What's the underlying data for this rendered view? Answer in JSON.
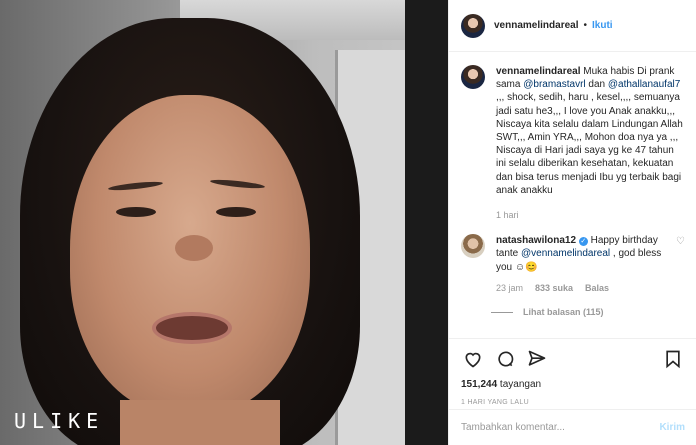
{
  "media": {
    "watermark": "ULIKE"
  },
  "header": {
    "username": "vennamelindareal",
    "separator": "•",
    "follow_label": "Ikuti"
  },
  "caption": {
    "username": "vennamelindareal",
    "text_1": " Muka habis Di prank sama ",
    "mention_1": "@bramastavrl",
    "text_2": " dan ",
    "mention_2": "@athallanaufal7",
    "text_3": " ,,, shock, sedih, haru , kesel,,,, semuanya jadi satu he3,,, I love you Anak anakku,,, Niscaya kita selalu dalam Lindungan Allah SWT,,, Amin YRA,,, Mohon doa nya ya ,,, Niscaya di Hari jadi saya yg ke 47 tahun ini selalu diberikan kesehatan, kekuatan dan bisa terus menjadi Ibu yg terbaik bagi anak anakku",
    "age": "1 hari"
  },
  "comment": {
    "username": "natashawilona12",
    "text_1": " Happy birthday tante ",
    "mention": "@vennamelindareal",
    "text_2": " , god bless you ☺😊",
    "age": "23 jam",
    "likes": "833 suka",
    "reply": "Balas",
    "view_replies": "Lihat balasan (115)"
  },
  "actions": {
    "views_count": "151,244",
    "views_label": " tayangan",
    "time": "1 HARI YANG LALU"
  },
  "add_comment": {
    "placeholder": "Tambahkan komentar...",
    "post_label": "Kirim"
  },
  "colors": {
    "link": "#3897f0",
    "mention": "#003569",
    "muted": "#999999"
  }
}
